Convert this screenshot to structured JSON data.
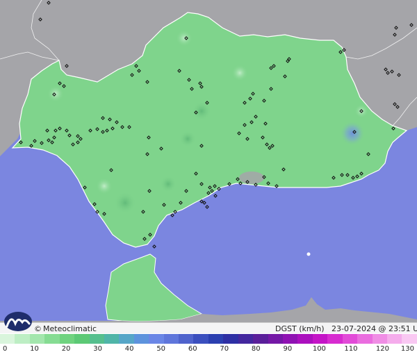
{
  "brand": {
    "symbol": "©",
    "name": "Meteoclimatic"
  },
  "variable_label": "DGST (km/h)",
  "timestamp": "23-07-2024 @ 23:51 UTC",
  "colors": {
    "sea": "#7b86e0",
    "land_outside": "#a5a5a9",
    "land_andalusia": "#7fd48c",
    "border": "#ffffff",
    "station": "#111111"
  },
  "scale": {
    "ticks": [
      "0",
      "10",
      "20",
      "30",
      "40",
      "50",
      "60",
      "70",
      "80",
      "90",
      "100",
      "110",
      "120",
      "130"
    ],
    "colors": [
      "#d9f5dc",
      "#bdeec4",
      "#a3e6ad",
      "#86dc93",
      "#6fd37f",
      "#5cc975",
      "#55bf8e",
      "#4fb5a8",
      "#56a6c8",
      "#5d93dd",
      "#6a86e6",
      "#5f76db",
      "#4f63cc",
      "#3b4fbe",
      "#2b3fb0",
      "#2e2fa4",
      "#43279e",
      "#5a1f9a",
      "#7418a6",
      "#8f12b3",
      "#ab10be",
      "#c415c7",
      "#d72cd0",
      "#e24bd8",
      "#ea6ddf",
      "#f08de5",
      "#f5acec",
      "#f9c8f2"
    ]
  }
}
